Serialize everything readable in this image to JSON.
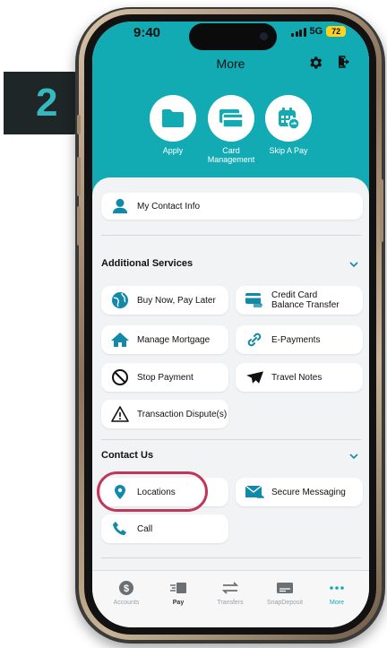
{
  "step_badge": "2",
  "status_bar": {
    "time": "9:40",
    "network": "5G",
    "battery": "72"
  },
  "header": {
    "title": "More"
  },
  "quick_actions": [
    {
      "label": "Apply"
    },
    {
      "label": "Card Management"
    },
    {
      "label": "Skip A Pay"
    }
  ],
  "contact_info": {
    "label": "My Contact Info"
  },
  "additional_services": {
    "title": "Additional Services",
    "items": [
      {
        "label": "Buy Now, Pay Later",
        "icon": "globe-icon"
      },
      {
        "label": "Credit Card Balance Transfer",
        "icon": "card-transfer-icon"
      },
      {
        "label": "Manage Mortgage",
        "icon": "house-icon"
      },
      {
        "label": "E-Payments",
        "icon": "link-icon"
      },
      {
        "label": "Stop Payment",
        "icon": "prohibited-icon"
      },
      {
        "label": "Travel Notes",
        "icon": "airplane-icon"
      },
      {
        "label": "Transaction Dispute(s)",
        "icon": "warning-icon"
      }
    ]
  },
  "contact_us": {
    "title": "Contact Us",
    "items": [
      {
        "label": "Locations",
        "icon": "map-pin-icon"
      },
      {
        "label": "Secure Messaging",
        "icon": "envelope-icon"
      },
      {
        "label": "Call",
        "icon": "phone-icon"
      }
    ]
  },
  "tab_bar": [
    {
      "label": "Accounts",
      "icon": "dollar-icon"
    },
    {
      "label": "Pay",
      "icon": "pay-icon"
    },
    {
      "label": "Transfers",
      "icon": "arrows-icon"
    },
    {
      "label": "SnapDeposit",
      "icon": "check-scan-icon"
    },
    {
      "label": "More",
      "icon": "more-dots-icon"
    }
  ],
  "colors": {
    "brand_teal": "#12aab3",
    "icon_blue": "#1189a8",
    "highlight": "#c0375b",
    "battery": "#ffd21f"
  }
}
